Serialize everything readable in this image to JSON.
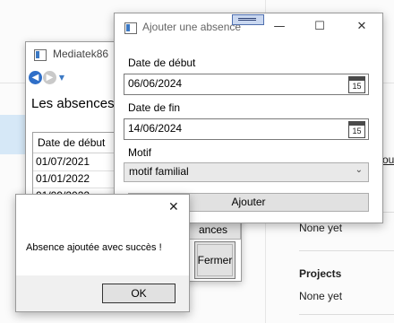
{
  "background": {
    "partial_label": "ou",
    "sections": [
      {
        "value": "None yet"
      },
      {
        "heading": "Projects",
        "value": "None yet"
      }
    ]
  },
  "main_window": {
    "title": "Mediatek86",
    "heading": "Les absences",
    "grid": {
      "column_header": "Date de début",
      "rows": [
        "01/07/2021",
        "01/01/2022",
        "01/09/2022"
      ]
    },
    "buttons": {
      "absences_partial": "ances",
      "close": "Fermer"
    }
  },
  "absence_dialog": {
    "title": "Ajouter une absence",
    "controls": {
      "minimize": "—",
      "maximize": "☐",
      "close": "✕"
    },
    "start_label": "Date de début",
    "start_value": "06/06/2024",
    "end_label": "Date de fin",
    "end_value": "14/06/2024",
    "calendar_day": "15",
    "reason_label": "Motif",
    "reason_value": "motif familial",
    "submit": "Ajouter"
  },
  "message_box": {
    "close_glyph": "✕",
    "message": "Absence ajoutée avec succès !",
    "ok": "OK"
  }
}
